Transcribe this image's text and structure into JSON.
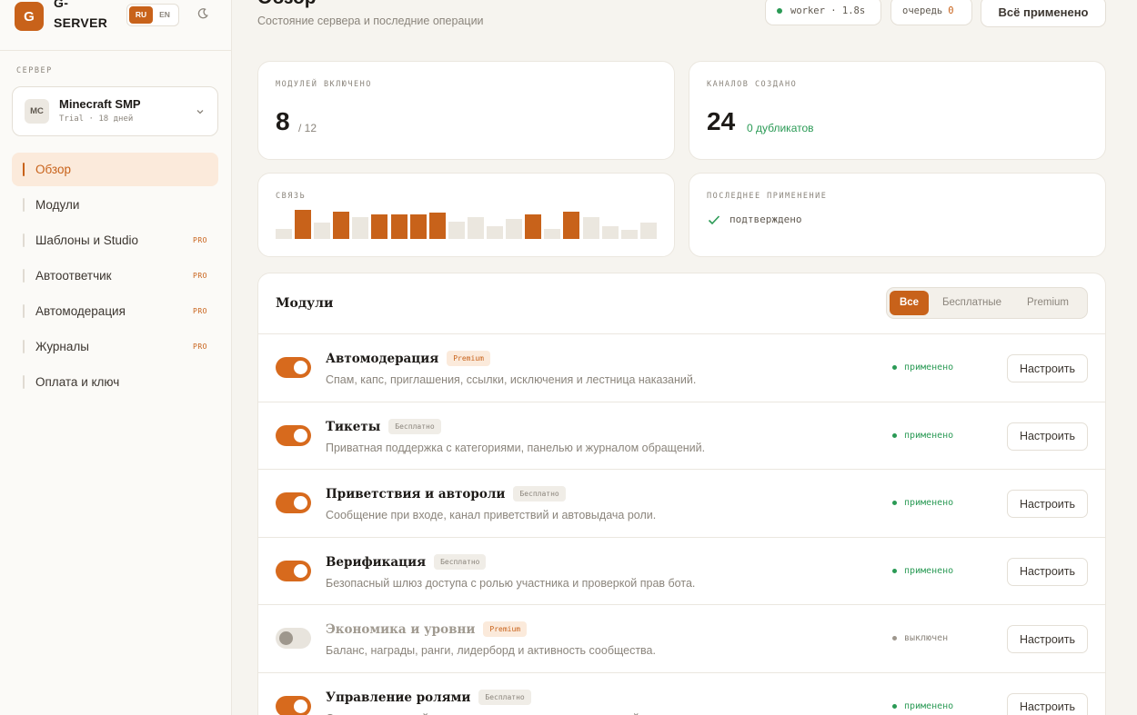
{
  "app": {
    "logo_letter": "G",
    "name": "G-SERVER"
  },
  "lang": {
    "ru": "RU",
    "en": "EN"
  },
  "sidebar": {
    "section_label": "СЕРВЕР",
    "server": {
      "initials": "MC",
      "name": "Minecraft SMP",
      "sub": "Trial · 18 дней"
    },
    "items": [
      {
        "label": "Обзор",
        "pro": ""
      },
      {
        "label": "Модули",
        "pro": ""
      },
      {
        "label": "Шаблоны и Studio",
        "pro": "PRO"
      },
      {
        "label": "Автоответчик",
        "pro": "PRO"
      },
      {
        "label": "Автомодерация",
        "pro": "PRO"
      },
      {
        "label": "Журналы",
        "pro": "PRO"
      },
      {
        "label": "Оплата и ключ",
        "pro": ""
      }
    ]
  },
  "header": {
    "title": "Обзор",
    "subtitle": "Состояние сервера и последние операции",
    "worker": "worker · 1.8s",
    "queue_label": "очередь",
    "queue_value": "0",
    "apply_button": "Всё применено"
  },
  "stats": {
    "modules": {
      "label": "МОДУЛЕЙ ВКЛЮЧЕНО",
      "value": "8",
      "total": "/ 12"
    },
    "channels": {
      "label": "КАНАЛОВ СОЗДАНО",
      "value": "24",
      "note": "0 дубликатов"
    },
    "link": {
      "label": "СВЯЗЬ",
      "bars": [
        0.35,
        1,
        0.55,
        0.95,
        0.75,
        0.85,
        0.85,
        0.85,
        0.9,
        0.6,
        0.75,
        0.45,
        0.7,
        0.85,
        0.35,
        0.95,
        0.75,
        0.45,
        0.3,
        0.55
      ],
      "active": [
        false,
        true,
        false,
        true,
        false,
        true,
        true,
        true,
        true,
        false,
        false,
        false,
        false,
        true,
        false,
        true,
        false,
        false,
        false,
        false
      ]
    },
    "last_apply": {
      "label": "ПОСЛЕДНЕЕ ПРИМЕНЕНИЕ",
      "status": "подтверждено"
    }
  },
  "modules": {
    "title": "Модули",
    "filters": {
      "all": "Все",
      "free": "Бесплатные",
      "premium": "Premium"
    },
    "configure_label": "Настроить",
    "rows": [
      {
        "name": "Автомодерация",
        "tier": "Premium",
        "tier_type": "premium",
        "desc": "Спам, капс, приглашения, ссылки, исключения и лестница наказаний.",
        "enabled": true,
        "status": "применено"
      },
      {
        "name": "Тикеты",
        "tier": "Бесплатно",
        "tier_type": "free",
        "desc": "Приватная поддержка с категориями, панелью и журналом обращений.",
        "enabled": true,
        "status": "применено"
      },
      {
        "name": "Приветствия и автороли",
        "tier": "Бесплатно",
        "tier_type": "free",
        "desc": "Сообщение при входе, канал приветствий и автовыдача роли.",
        "enabled": true,
        "status": "применено"
      },
      {
        "name": "Верификация",
        "tier": "Бесплатно",
        "tier_type": "free",
        "desc": "Безопасный шлюз доступа с ролью участника и проверкой прав бота.",
        "enabled": true,
        "status": "применено"
      },
      {
        "name": "Экономика и уровни",
        "tier": "Premium",
        "tier_type": "premium",
        "desc": "Баланс, награды, ранги, лидерборд и активность сообщества.",
        "enabled": false,
        "status": "выключен"
      },
      {
        "name": "Управление ролями",
        "tier": "Бесплатно",
        "tier_type": "free",
        "desc": "Самовыдача ролей, роли по реакциям и сохранение ролей участника.",
        "enabled": true,
        "status": "применено"
      }
    ]
  },
  "colors": {
    "accent": "#c8621a",
    "success": "#2a9a55",
    "bar_inactive": "#ebe7df"
  }
}
